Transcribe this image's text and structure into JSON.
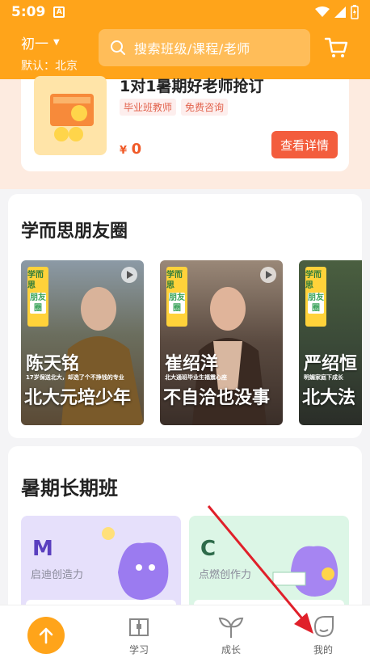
{
  "status_bar": {
    "time": "5:09",
    "a_icon": "A"
  },
  "header": {
    "grade": "初一",
    "location": "默认：北京",
    "search_placeholder": "搜索班级/课程/老师"
  },
  "promo": {
    "title": "1对1暑期好老师抢订",
    "tags": [
      "毕业班教师",
      "免费咨询"
    ],
    "currency": "¥",
    "price": "0",
    "button": "查看详情"
  },
  "friends": {
    "title": "学而思朋友圈",
    "badge_top": "学而思",
    "badge_bottom": "朋友圈",
    "videos": [
      {
        "name": "陈天铭",
        "sub": "17岁保送北大，却选了个不挣钱的专业",
        "slogan": "北大元培少年"
      },
      {
        "name": "崔绍洋",
        "sub": "北大通班毕业生福震心座",
        "slogan": "不自洽也没事"
      },
      {
        "name": "严绍恒",
        "sub": "明媚家庭下成长",
        "slogan": "北大法"
      }
    ]
  },
  "summer": {
    "title": "暑期长期班",
    "courses": [
      {
        "letter": "M",
        "name": "启迪创造力"
      },
      {
        "letter": "C",
        "name": "点燃创作力"
      }
    ]
  },
  "tabbar": {
    "tabs": [
      {
        "label": "学习",
        "icon": "book-icon"
      },
      {
        "label": "成长",
        "icon": "sprout-icon"
      },
      {
        "label": "我的",
        "icon": "profile-face-icon"
      }
    ]
  },
  "colors": {
    "brand": "#ffa41a",
    "accent_red": "#f35d3d",
    "arrow": "#e0202a"
  }
}
